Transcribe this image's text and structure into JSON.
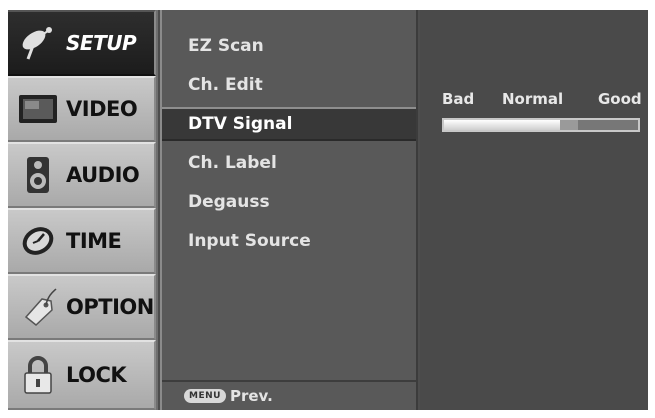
{
  "categories": [
    {
      "label": "SETUP",
      "icon": "satellite-dish-icon",
      "active": true
    },
    {
      "label": "VIDEO",
      "icon": "monitor-icon",
      "active": false
    },
    {
      "label": "AUDIO",
      "icon": "speaker-icon",
      "active": false
    },
    {
      "label": "TIME",
      "icon": "clock-icon",
      "active": false
    },
    {
      "label": "OPTION",
      "icon": "tag-icon",
      "active": false
    },
    {
      "label": "LOCK",
      "icon": "padlock-icon",
      "active": false
    }
  ],
  "menu": {
    "items": [
      "EZ Scan",
      "Ch. Edit",
      "DTV Signal",
      "Ch. Label",
      "Degauss",
      "Input Source"
    ],
    "selected_index": 2,
    "footer": {
      "key_label": "MENU",
      "action_label": "Prev."
    }
  },
  "signal": {
    "labels": {
      "bad": "Bad",
      "normal": "Normal",
      "good": "Good"
    },
    "strength": 0.6
  },
  "colors": {
    "background": "#4d4d4d",
    "active_tab": "#1c1c1c",
    "inactive_tab": "#b8b8b8",
    "selected_item": "#383838"
  }
}
